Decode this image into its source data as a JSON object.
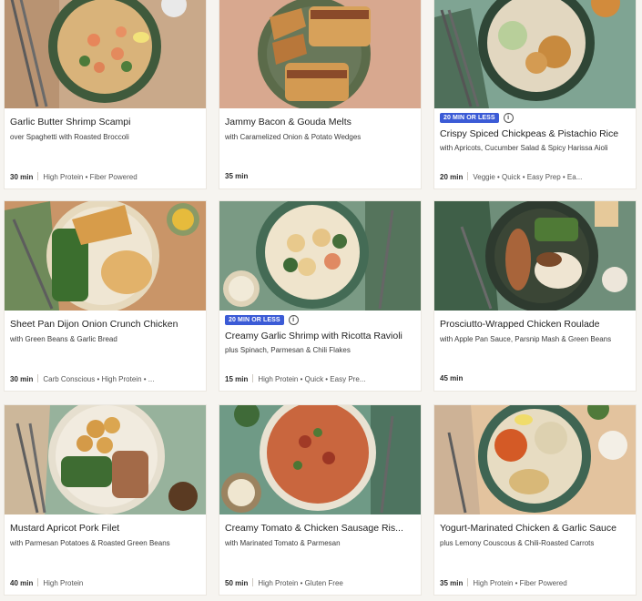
{
  "cards": [
    {
      "title": "Garlic Butter Shrimp Scampi",
      "subtitle": "over Spaghetti with Roasted Broccoli",
      "time": "30 min",
      "tags": "High Protein • Fiber Powered",
      "badge": ""
    },
    {
      "title": "Jammy Bacon & Gouda Melts",
      "subtitle": "with Caramelized Onion & Potato Wedges",
      "time": "35 min",
      "tags": "",
      "badge": ""
    },
    {
      "title": "Crispy Spiced Chickpeas & Pistachio Rice",
      "subtitle": "with Apricots, Cucumber Salad & Spicy Harissa Aioli",
      "time": "20 min",
      "tags": "Veggie • Quick • Easy Prep • Ea...",
      "badge": "20 MIN OR LESS"
    },
    {
      "title": "Sheet Pan Dijon Onion Crunch Chicken",
      "subtitle": "with Green Beans & Garlic Bread",
      "time": "30 min",
      "tags": "Carb Conscious • High Protein • ...",
      "badge": ""
    },
    {
      "title": "Creamy Garlic Shrimp with Ricotta Ravioli",
      "subtitle": "plus Spinach, Parmesan & Chili Flakes",
      "time": "15 min",
      "tags": "High Protein • Quick • Easy Pre...",
      "badge": "20 MIN OR LESS"
    },
    {
      "title": "Prosciutto-Wrapped Chicken Roulade",
      "subtitle": "with Apple Pan Sauce, Parsnip Mash & Green Beans",
      "time": "45 min",
      "tags": "",
      "badge": ""
    },
    {
      "title": "Mustard Apricot Pork Filet",
      "subtitle": "with Parmesan Potatoes & Roasted Green Beans",
      "time": "40 min",
      "tags": "High Protein",
      "badge": ""
    },
    {
      "title": "Creamy Tomato & Chicken Sausage Ris...",
      "subtitle": "with Marinated Tomato & Parmesan",
      "time": "50 min",
      "tags": "High Protein • Gluten Free",
      "badge": ""
    },
    {
      "title": "Yogurt-Marinated Chicken & Garlic Sauce",
      "subtitle": "plus Lemony Couscous & Chili-Roasted Carrots",
      "time": "35 min",
      "tags": "High Protein • Fiber Powered",
      "badge": ""
    }
  ],
  "info_icon": "info-icon",
  "colors": {
    "badge": "#3b5bd6",
    "background": "#f6f4f0"
  }
}
